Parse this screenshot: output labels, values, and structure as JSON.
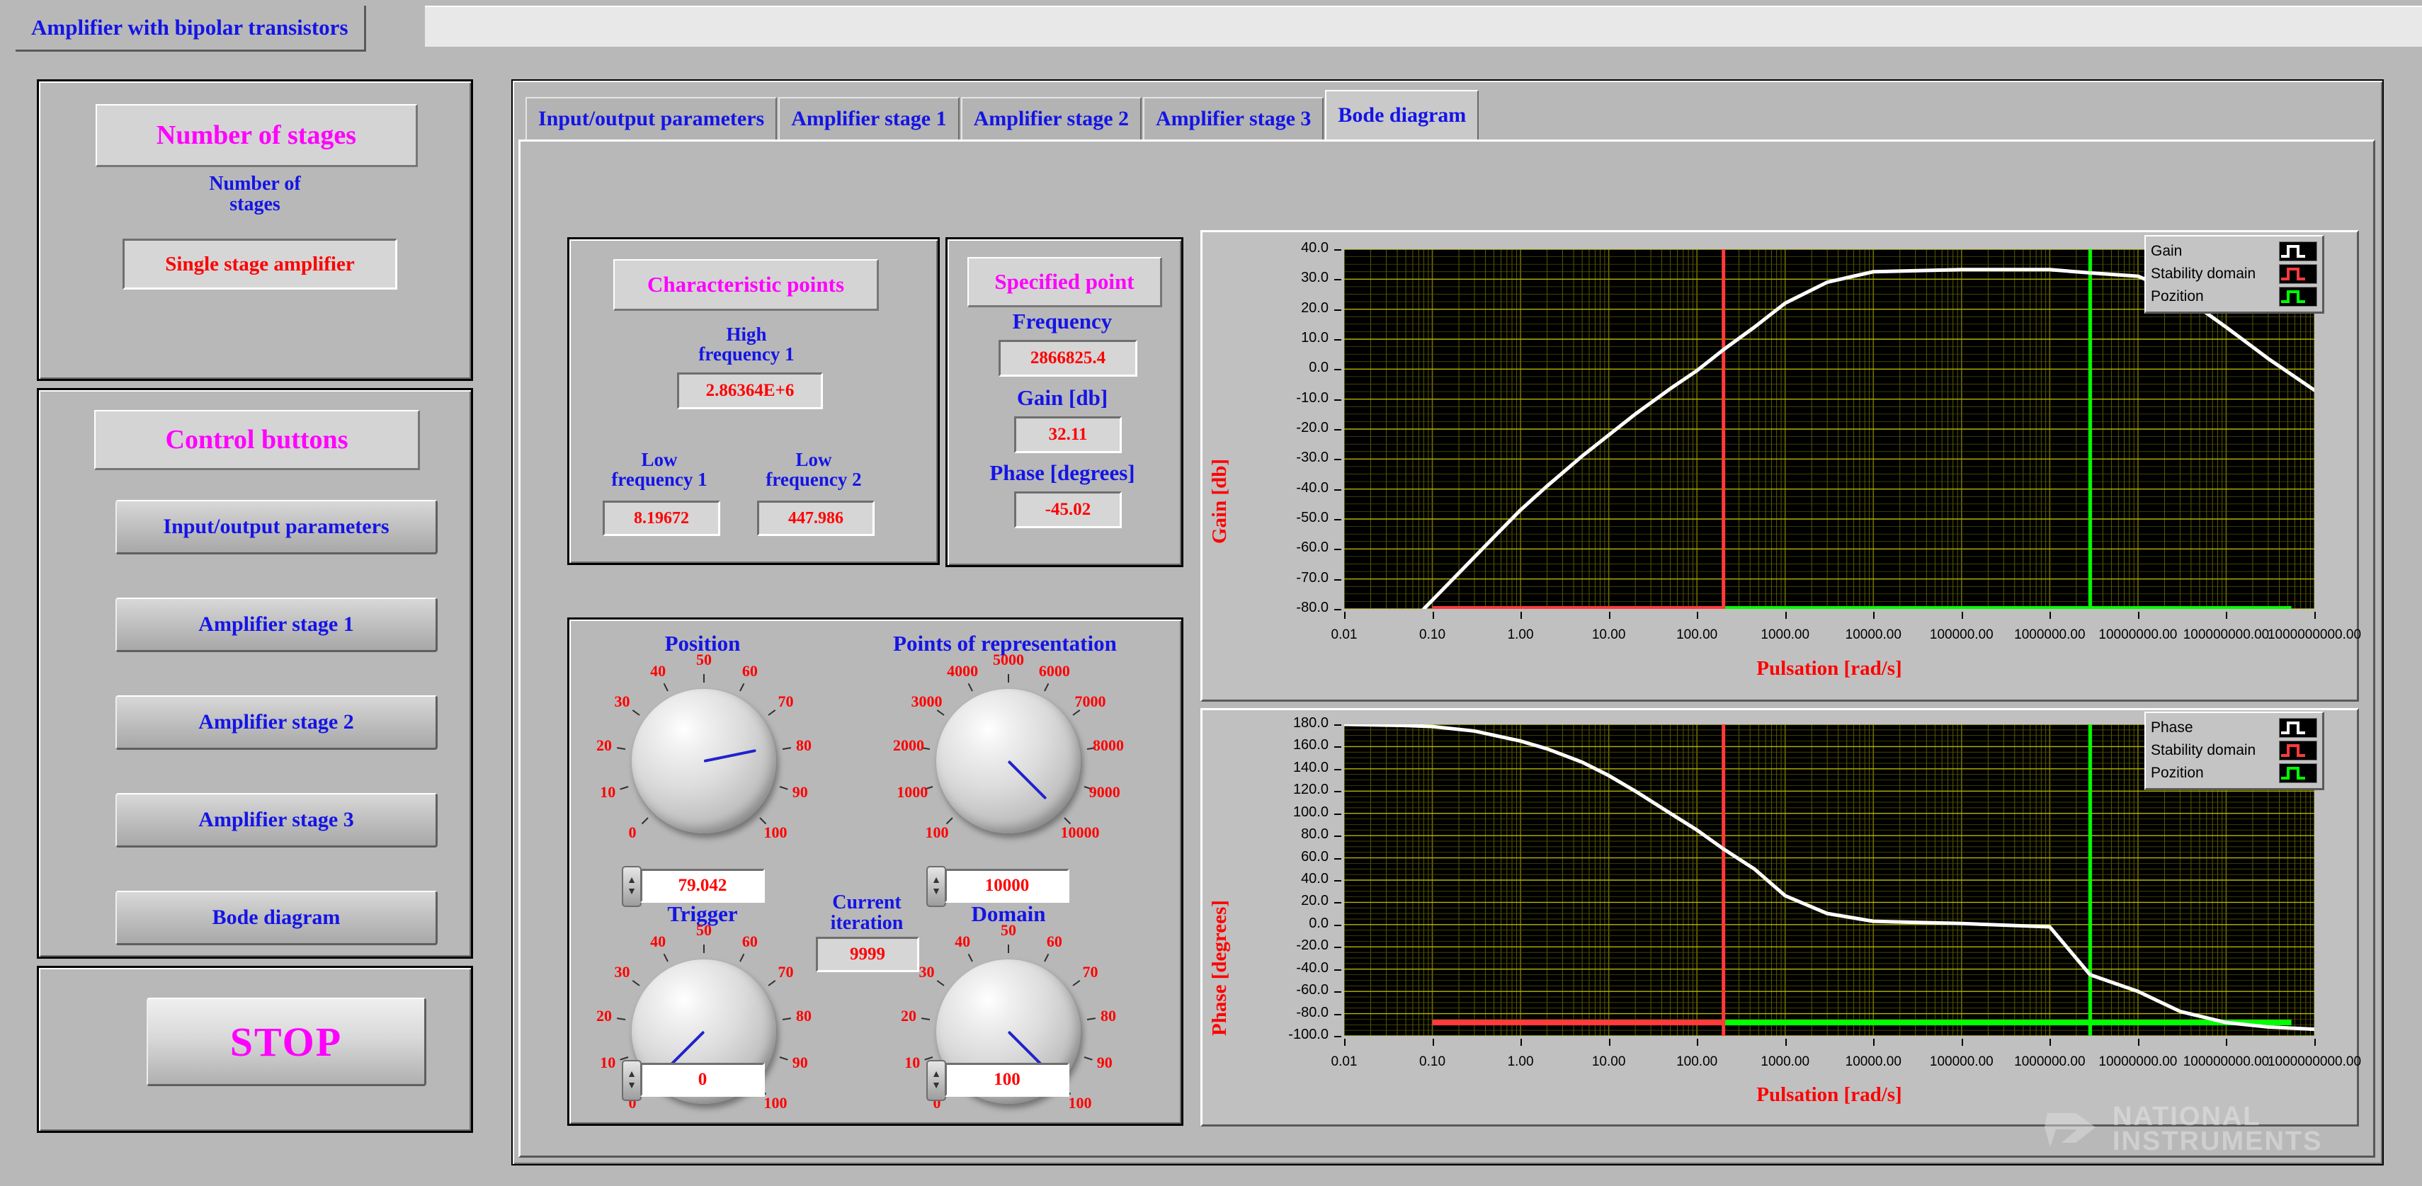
{
  "window": {
    "title": "Amplifier with bipolar transistors"
  },
  "sidebar": {
    "stages_group": {
      "plaque": "Number of stages",
      "caption_line1": "Number of",
      "caption_line2": "stages",
      "value": "Single stage amplifier"
    },
    "controls_group": {
      "plaque": "Control buttons",
      "buttons": [
        {
          "label": "Input/output parameters"
        },
        {
          "label": "Amplifier stage 1"
        },
        {
          "label": "Amplifier stage 2"
        },
        {
          "label": "Amplifier stage 3"
        },
        {
          "label": "Bode diagram"
        }
      ]
    },
    "stop_group": {
      "label": "STOP"
    }
  },
  "tabs": [
    {
      "label": "Input/output parameters",
      "active": false
    },
    {
      "label": "Amplifier stage 1",
      "active": false
    },
    {
      "label": "Amplifier stage 2",
      "active": false
    },
    {
      "label": "Amplifier stage 3",
      "active": false
    },
    {
      "label": "Bode diagram",
      "active": true
    }
  ],
  "characteristic_points": {
    "plaque": "Characteristic points",
    "high_freq_1_label_l1": "High",
    "high_freq_1_label_l2": "frequency 1",
    "high_freq_1_value": "2.86364E+6",
    "low_freq_1_label_l1": "Low",
    "low_freq_1_label_l2": "frequency 1",
    "low_freq_1_value": "8.19672",
    "low_freq_2_label_l1": "Low",
    "low_freq_2_label_l2": "frequency 2",
    "low_freq_2_value": "447.986"
  },
  "specified_point": {
    "plaque": "Specified point",
    "frequency_label": "Frequency",
    "frequency_value": "2866825.4",
    "gain_label": "Gain [db]",
    "gain_value": "32.11",
    "phase_label": "Phase [degrees]",
    "phase_value": "-45.02"
  },
  "knobs": {
    "position": {
      "label": "Position",
      "value": "79.042",
      "min": 0,
      "max": 100,
      "ticks": [
        "0",
        "10",
        "20",
        "30",
        "40",
        "50",
        "60",
        "70",
        "80",
        "90",
        "100"
      ]
    },
    "points_of_representation": {
      "label": "Points of representation",
      "value": "10000",
      "min": 100,
      "max": 10000,
      "ticks": [
        "100",
        "1000",
        "2000",
        "3000",
        "4000",
        "5000",
        "6000",
        "7000",
        "8000",
        "9000",
        "10000"
      ]
    },
    "trigger": {
      "label": "Trigger",
      "value": "0",
      "min": 0,
      "max": 100,
      "ticks": [
        "0",
        "10",
        "20",
        "30",
        "40",
        "50",
        "60",
        "70",
        "80",
        "90",
        "100"
      ]
    },
    "domain": {
      "label": "Domain",
      "value": "100",
      "min": 0,
      "max": 100,
      "ticks": [
        "0",
        "10",
        "20",
        "30",
        "40",
        "50",
        "60",
        "70",
        "80",
        "90",
        "100"
      ]
    },
    "current_iteration": {
      "label_l1": "Current",
      "label_l2": "iteration",
      "value": "9999"
    }
  },
  "colors": {
    "trace": "#ffffff",
    "stability_domain": "#ff3b3b",
    "pozition": "#00ff00",
    "grid": "#b8b800",
    "plot_bg": "#000000",
    "panel_bg": "#b8b8b8",
    "label_blue": "#1414e6",
    "value_red": "#ff0000",
    "plaque_magenta": "#ff00ff"
  },
  "branding": {
    "line1": "NATIONAL",
    "line2": "INSTRUMENTS"
  },
  "chart_data": [
    {
      "type": "line",
      "id": "gain_plot",
      "title": "",
      "xlabel": "Pulsation [rad/s]",
      "ylabel": "Gain [db]",
      "xscale": "log",
      "xlim": [
        0.01,
        1000000000.0
      ],
      "ylim": [
        -80.0,
        40.0
      ],
      "grid": true,
      "xticks": [
        "0.01",
        "0.10",
        "1.00",
        "10.00",
        "100.00",
        "1000.00",
        "10000.00",
        "100000.00",
        "1000000.00",
        "10000000.00",
        "100000000.00",
        "1000000000.00"
      ],
      "yticks": [
        "40.0",
        "30.0",
        "20.0",
        "10.0",
        "0.0",
        "-10.0",
        "-20.0",
        "-30.0",
        "-40.0",
        "-50.0",
        "-60.0",
        "-70.0",
        "-80.0"
      ],
      "legend_position": "top-right",
      "series": [
        {
          "name": "Gain",
          "color": "#ffffff",
          "x": [
            0.08,
            0.2,
            0.5,
            1,
            2,
            5,
            10,
            20,
            50,
            100,
            200,
            447.986,
            1000,
            3000,
            10000,
            100000,
            1000000,
            2866825.4,
            10000000,
            30000000,
            100000000,
            300000000,
            1000000000
          ],
          "y": [
            -80,
            -68,
            -56,
            -47,
            -39,
            -29,
            -22,
            -15,
            -6.5,
            -0.5,
            6.5,
            14,
            22,
            29,
            32.5,
            33.2,
            33.2,
            32.11,
            31,
            25,
            14,
            3.5,
            -7
          ]
        },
        {
          "name": "Stability domain",
          "color": "#ff3b3b",
          "annotation": "vertical marker at 200 rad/s plus horizontal baseline at -80 db from 0.01 to 200"
        },
        {
          "name": "Pozition",
          "color": "#00ff00",
          "annotation": "vertical marker at 2866825.4 rad/s plus horizontal baseline at -80 db from 200 to 1e9"
        }
      ],
      "markers": {
        "stability_x": 200,
        "pozition_x": 2866825.4
      }
    },
    {
      "type": "line",
      "id": "phase_plot",
      "title": "",
      "xlabel": "Pulsation [rad/s]",
      "ylabel": "Phase [degrees]",
      "xscale": "log",
      "xlim": [
        0.01,
        1000000000.0
      ],
      "ylim": [
        -100.0,
        180.0
      ],
      "grid": true,
      "xticks": [
        "0.01",
        "0.10",
        "1.00",
        "10.00",
        "100.00",
        "1000.00",
        "10000.00",
        "100000.00",
        "1000000.00",
        "10000000.00",
        "100000000.00",
        "1000000000.00"
      ],
      "yticks": [
        "180.0",
        "160.0",
        "140.0",
        "120.0",
        "100.0",
        "80.0",
        "60.0",
        "40.0",
        "20.0",
        "0.0",
        "-20.0",
        "-40.0",
        "-60.0",
        "-80.0",
        "-100.0"
      ],
      "legend_position": "top-right",
      "series": [
        {
          "name": "Phase",
          "color": "#ffffff",
          "x": [
            0.01,
            0.05,
            0.1,
            0.3,
            1,
            2,
            5,
            10,
            20,
            50,
            100,
            200,
            447.986,
            1000,
            3000,
            10000,
            100000,
            1000000,
            2866825.4,
            10000000,
            30000000,
            100000000,
            300000000,
            1000000000
          ],
          "y": [
            180,
            179,
            178,
            174,
            165,
            158,
            146,
            134,
            120,
            100,
            85,
            68,
            50,
            26,
            10,
            3,
            1,
            -2,
            -45.02,
            -60,
            -78,
            -88,
            -92,
            -94
          ]
        },
        {
          "name": "Stability domain",
          "color": "#ff3b3b",
          "annotation": "vertical marker at 200 rad/s plus horizontal baseline at -88 deg from 0.1 to 200"
        },
        {
          "name": "Pozition",
          "color": "#00ff00",
          "annotation": "vertical marker at 2866825.4 rad/s plus horizontal baseline at -88 deg from 200 to 1e9"
        }
      ],
      "markers": {
        "stability_x": 200,
        "pozition_x": 2866825.4
      }
    }
  ]
}
